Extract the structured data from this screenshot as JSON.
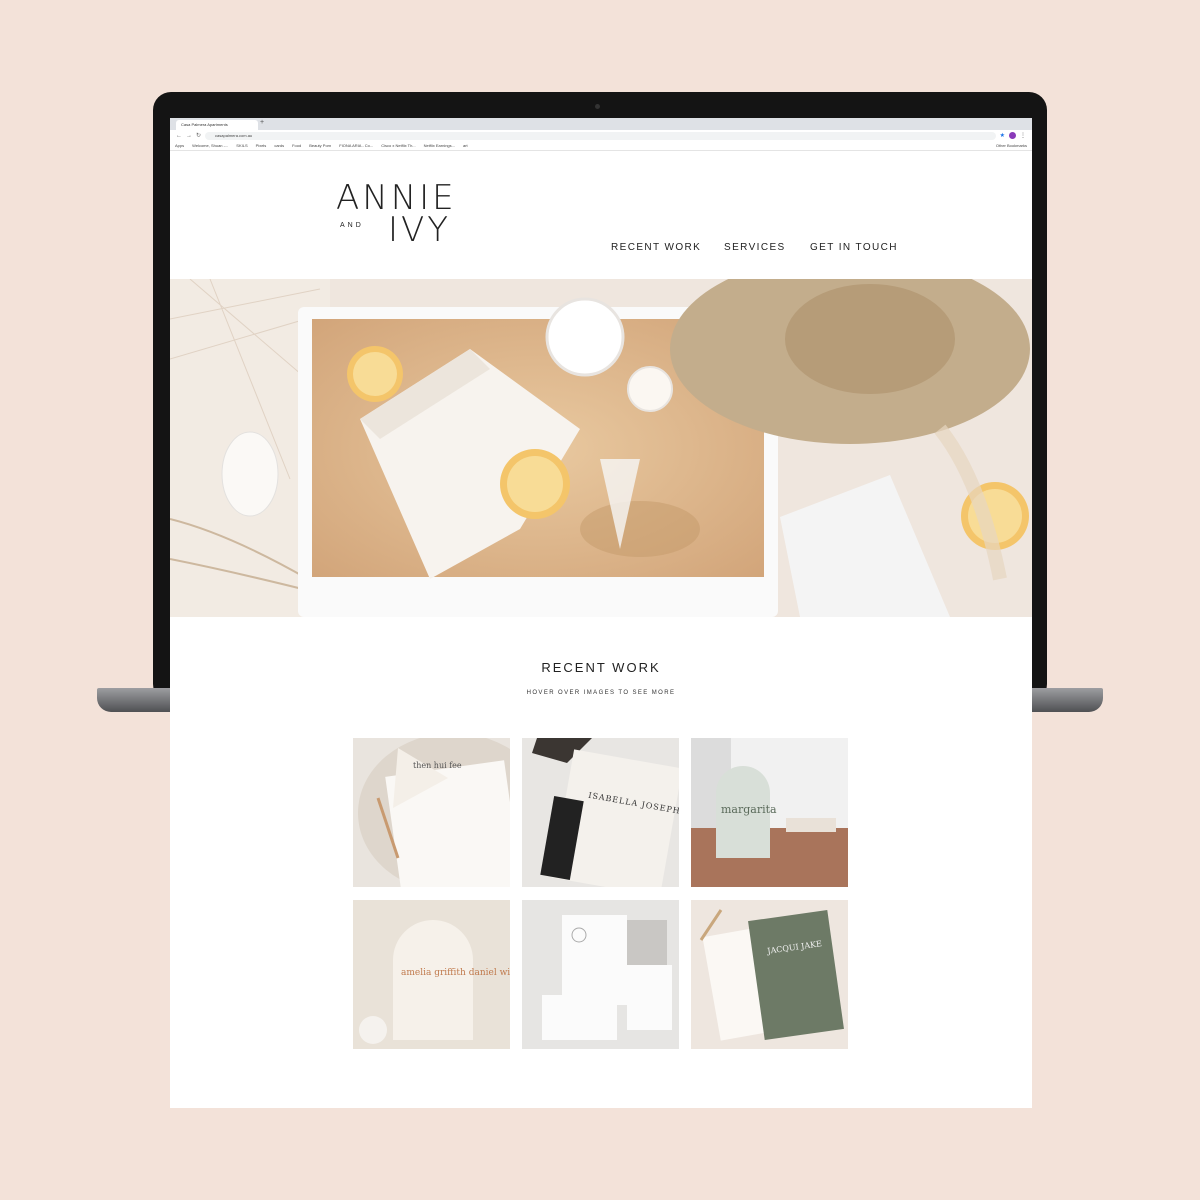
{
  "browser": {
    "tab_title": "Casa Palmera Apartments",
    "new_tab": "+",
    "url": "casapalmera.com.au",
    "bookmarks": [
      "Apps",
      "Welcome, Shuan -...",
      "SKILS",
      "Pixels",
      "cards",
      "Food",
      "Beauty Porn",
      "FIONA ARIA - Co...",
      "Cisco x Netflix Th...",
      "Netflix Earnings...",
      "art"
    ],
    "other_bookmarks": "Other Bookmarks"
  },
  "site": {
    "logo_top": "ANNIE",
    "logo_and": "AND",
    "logo_bottom": "IVY",
    "nav": [
      "RECENT WORK",
      "SERVICES",
      "GET IN TOUCH"
    ]
  },
  "recent_work": {
    "title": "RECENT WORK",
    "subtitle": "HOVER OVER IMAGES TO SEE MORE",
    "items": [
      {
        "text": "then hui fee",
        "alt": "menu card with dried flower"
      },
      {
        "text": "ISABELLA JOSEPH",
        "alt": "wedding invitation"
      },
      {
        "text": "margarita",
        "alt": "arched cocktail sign"
      },
      {
        "text": "amelia griffith daniel wilkinson",
        "alt": "arched invitation"
      },
      {
        "text": "",
        "alt": "stationery suite"
      },
      {
        "text": "JACQUI JAKE",
        "alt": "green invitation suite"
      }
    ]
  },
  "colors": {
    "page_bg": "#f3e2d9",
    "accent_text": "#222222"
  }
}
